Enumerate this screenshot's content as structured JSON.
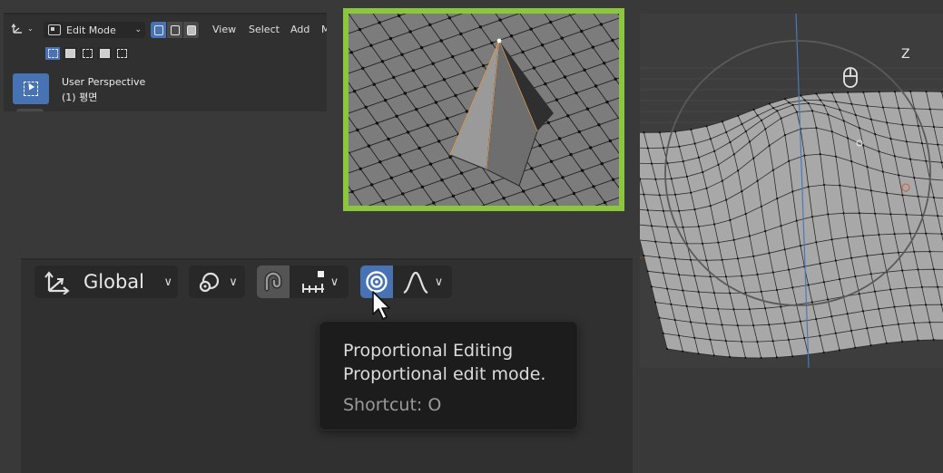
{
  "header": {
    "mode": "Edit Mode",
    "menus": [
      "View",
      "Select",
      "Add",
      "M"
    ],
    "viewport_name": "User Perspective",
    "object_info": "(1) 평면",
    "editor_type_icon": "axis-editor-icon",
    "select_mode_active": "vertex"
  },
  "toolbar": {
    "orientation_label": "Global",
    "orientation_icon": "transform-orientation-icon",
    "pivot_icon": "pivot-point-icon",
    "snap_icon": "snap-magnet-icon",
    "snap_target_icon": "snap-increment-icon",
    "proportional_icon": "proportional-editing-icon",
    "falloff_icon": "falloff-curve-icon",
    "proportional_active": true,
    "accent": "#4772b3"
  },
  "tooltip": {
    "title": "Proportional Editing",
    "description": "Proportional edit mode.",
    "shortcut": "Shortcut: O"
  },
  "viewport": {
    "axis_label": "Z",
    "navigation_icon": "mouse-icon"
  },
  "inset": {
    "highlight_color": "#8cc63f"
  }
}
